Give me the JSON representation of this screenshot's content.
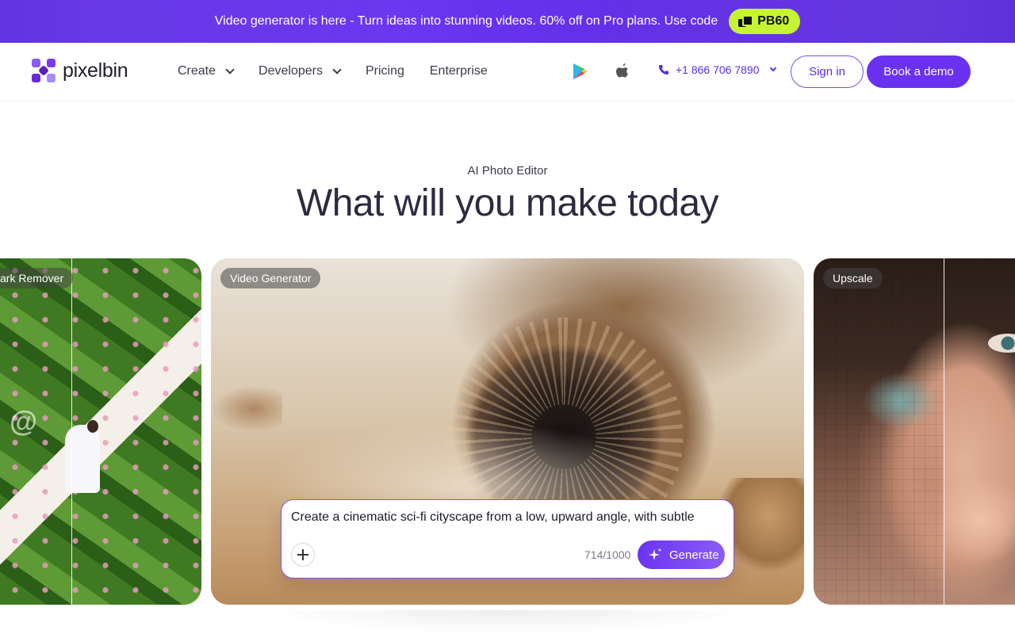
{
  "promo": {
    "text": "Video generator is here - Turn ideas into stunning videos. 60% off on Pro plans. Use code",
    "code": "PB60"
  },
  "header": {
    "logo": "pixelbin",
    "nav": [
      {
        "label": "Create",
        "has_dropdown": true
      },
      {
        "label": "Developers",
        "has_dropdown": true
      },
      {
        "label": "Pricing",
        "has_dropdown": false
      },
      {
        "label": "Enterprise",
        "has_dropdown": false
      }
    ],
    "phone": "+1 866 706 7890",
    "signin": "Sign in",
    "demo": "Book a demo"
  },
  "hero": {
    "eyebrow": "AI Photo Editor",
    "title": "What will you make today"
  },
  "cards": {
    "left_label": "ark Remover",
    "mid_label": "Video Generator",
    "right_label": "Upscale",
    "watermark": "@"
  },
  "prompt": {
    "text": "Create a cinematic sci-fi cityscape from a low, upward angle, with subtle",
    "counter": "714/1000",
    "generate": "Generate"
  },
  "colors": {
    "brand": "#6a32f0",
    "promo_code_bg": "#c6f432"
  }
}
